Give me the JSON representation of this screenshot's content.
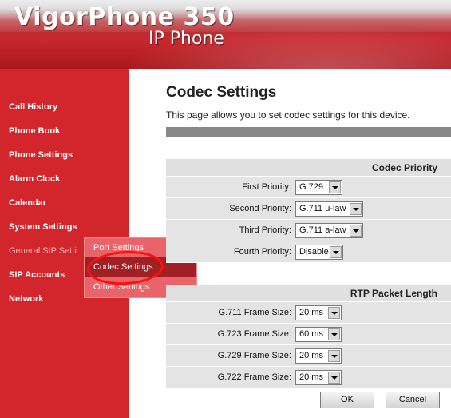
{
  "header": {
    "brand": "VigorPhone 350",
    "subtitle": "IP Phone"
  },
  "sidebar": {
    "items": [
      {
        "label": "Call History"
      },
      {
        "label": "Phone Book"
      },
      {
        "label": "Phone Settings"
      },
      {
        "label": "Alarm Clock"
      },
      {
        "label": "Calendar"
      },
      {
        "label": "System Settings"
      },
      {
        "label": "General SIP Setti"
      },
      {
        "label": "SIP Accounts"
      },
      {
        "label": "Network"
      }
    ],
    "submenu": [
      {
        "label": "Port Settings"
      },
      {
        "label": "Codec Settings"
      },
      {
        "label": "Other Settings"
      }
    ]
  },
  "main": {
    "title": "Codec Settings",
    "description": "This page allows you to set codec settings for this device.",
    "codec_priority": {
      "heading": "Codec Priority",
      "rows": [
        {
          "label": "First Priority:",
          "value": "G.729"
        },
        {
          "label": "Second Priority:",
          "value": "G.711 u-law"
        },
        {
          "label": "Third Priority:",
          "value": "G.711 a-law"
        },
        {
          "label": "Fourth Priority:",
          "value": "Disable"
        }
      ]
    },
    "rtp_packet_length": {
      "heading": "RTP Packet Length",
      "rows": [
        {
          "label": "G.711 Frame Size:",
          "value": "20 ms"
        },
        {
          "label": "G.723 Frame Size:",
          "value": "60 ms"
        },
        {
          "label": "G.729 Frame Size:",
          "value": "20 ms"
        },
        {
          "label": "G.722 Frame Size:",
          "value": "20 ms"
        }
      ]
    },
    "buttons": {
      "ok": "OK",
      "cancel": "Cancel"
    }
  },
  "colors": {
    "sidebar": "#d3252c",
    "submenu_bg": "#e96468",
    "submenu_active": "#a12024",
    "annotation": "#ff1010",
    "section_bg": "#e4e4e4"
  }
}
